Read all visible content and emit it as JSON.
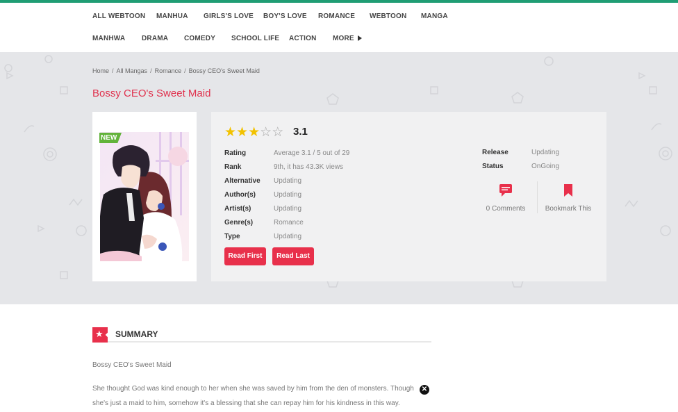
{
  "colors": {
    "brand_green": "#1f9d74",
    "accent_red": "#e8304b",
    "star_yellow": "#f2c200",
    "new_badge": "#62b33a"
  },
  "nav": {
    "row1": [
      "ALL WEBTOON",
      "MANHUA",
      "GIRLS'S LOVE",
      "BOY'S LOVE",
      "ROMANCE",
      "WEBTOON",
      "MANGA"
    ],
    "row2": [
      "MANHWA",
      "DRAMA",
      "COMEDY",
      "SCHOOL LIFE",
      "ACTION",
      "MORE"
    ]
  },
  "breadcrumb": [
    "Home",
    "All Mangas",
    "Romance",
    "Bossy CEO's Sweet Maid"
  ],
  "manga": {
    "title": "Bossy CEO's Sweet Maid",
    "badge": "NEW",
    "stars_filled": 3,
    "stars_total": 5,
    "score": "3.1",
    "details": [
      {
        "label": "Rating",
        "value": "Average 3.1 / 5 out of 29"
      },
      {
        "label": "Rank",
        "value": "9th, it has 43.3K views"
      },
      {
        "label": "Alternative",
        "value": "Updating"
      },
      {
        "label": "Author(s)",
        "value": "Updating"
      },
      {
        "label": "Artist(s)",
        "value": "Updating"
      },
      {
        "label": "Genre(s)",
        "value": "Romance"
      },
      {
        "label": "Type",
        "value": "Updating"
      }
    ],
    "right_details": [
      {
        "label": "Release",
        "value": "Updating"
      },
      {
        "label": "Status",
        "value": "OnGoing"
      }
    ],
    "read_first": "Read First",
    "read_last": "Read Last",
    "comments": "0 Comments",
    "bookmark": "Bookmark This",
    "icons": {
      "comments": "comments-icon",
      "bookmark": "bookmark-icon",
      "close": "close-icon"
    }
  },
  "summary": {
    "heading": "SUMMARY",
    "subtitle": "Bossy CEO's Sweet Maid",
    "line1": "She thought God was kind enough to her when she was saved by him from the den of monsters. Though",
    "line2": "she's just a maid to him, somehow it's a blessing that she can repay him for his kindness in this way."
  }
}
